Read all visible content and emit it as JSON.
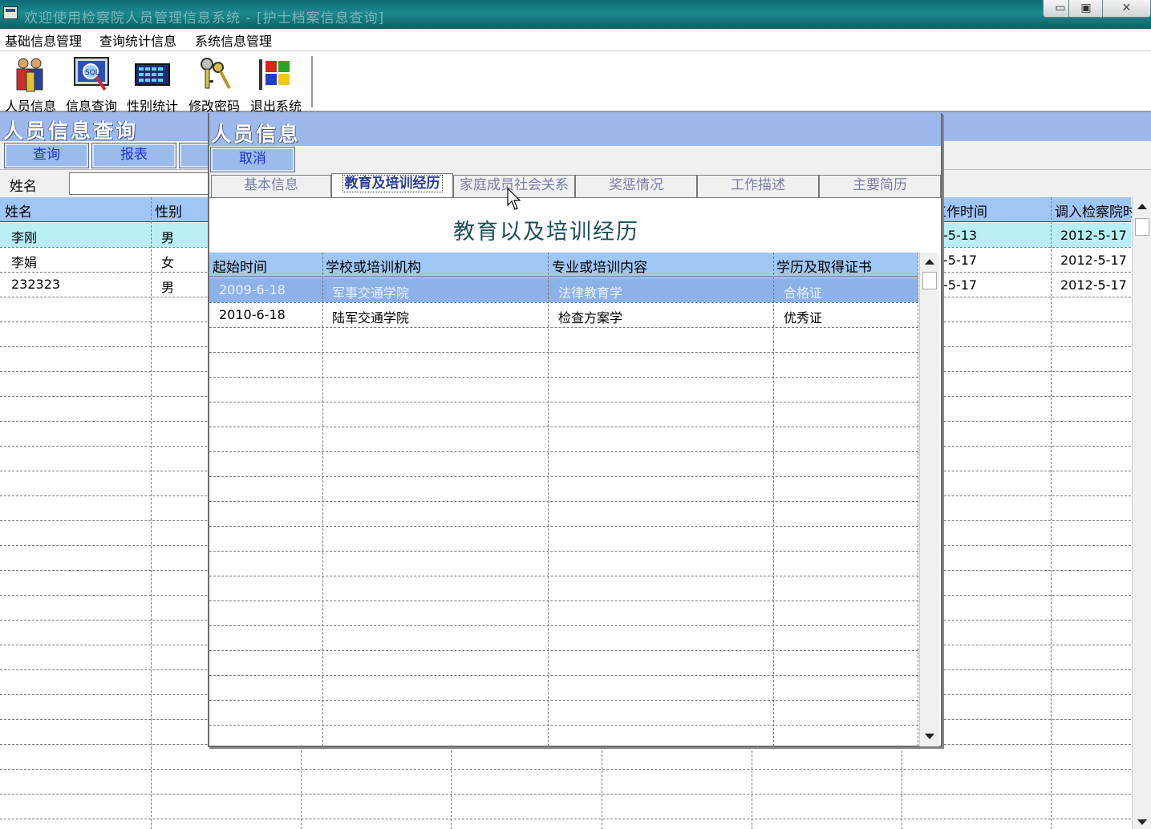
{
  "window": {
    "title": "欢迎使用检察院人员管理信息系统 - [护士档案信息查询]",
    "min_glyph": "▭",
    "max_glyph": "▣",
    "close_glyph": "✕"
  },
  "menu": [
    "基础信息管理",
    "查询统计信息",
    "系统信息管理"
  ],
  "toolbar": [
    {
      "label": "人员信息",
      "icon": "people-icon"
    },
    {
      "label": "信息查询",
      "icon": "sql-search-icon"
    },
    {
      "label": "性别统计",
      "icon": "calculator-icon"
    },
    {
      "label": "修改密码",
      "icon": "keys-icon"
    },
    {
      "label": "退出系统",
      "icon": "exit-flag-icon"
    }
  ],
  "query_panel": {
    "title": "人员信息查询",
    "buttons": [
      "查询",
      "报表"
    ],
    "name_label": "姓名",
    "name_value": ""
  },
  "person_grid": {
    "columns": [
      "姓名",
      "性别",
      "工作时间",
      "调入检察院时"
    ],
    "rows": [
      {
        "name": "李刚",
        "gender": "男",
        "work_time": "-5-13",
        "join_time": "2012-5-17"
      },
      {
        "name": "李娟",
        "gender": "女",
        "work_time": "-5-17",
        "join_time": "2012-5-17"
      },
      {
        "name": "232323",
        "gender": "男",
        "work_time": "-5-17",
        "join_time": "2012-5-17"
      }
    ]
  },
  "modal": {
    "title": "人员信息",
    "cancel_label": "取消",
    "tabs": [
      "基本信息",
      "教育及培训经历",
      "家庭成员社会关系",
      "奖惩情况",
      "工作描述",
      "主要简历"
    ],
    "active_tab": 1,
    "section_title": "教育以及培训经历",
    "columns": [
      "起始时间",
      "学校或培训机构",
      "专业或培训内容",
      "学历及取得证书"
    ],
    "rows": [
      [
        "2009-6-18",
        "军事交通学院",
        "法律教育学",
        "合格证"
      ],
      [
        "2010-6-18",
        "陆军交通学院",
        "检查方案学",
        "优秀证"
      ]
    ]
  },
  "colors": {
    "header_blue": "#9db8ea",
    "grid_header": "#9fc7f5",
    "selected_row_bg": "#b8eef5",
    "selected_edu_row": "#8db2e8",
    "button_text": "#1b36c6",
    "titlebar": "#0b6a72"
  }
}
